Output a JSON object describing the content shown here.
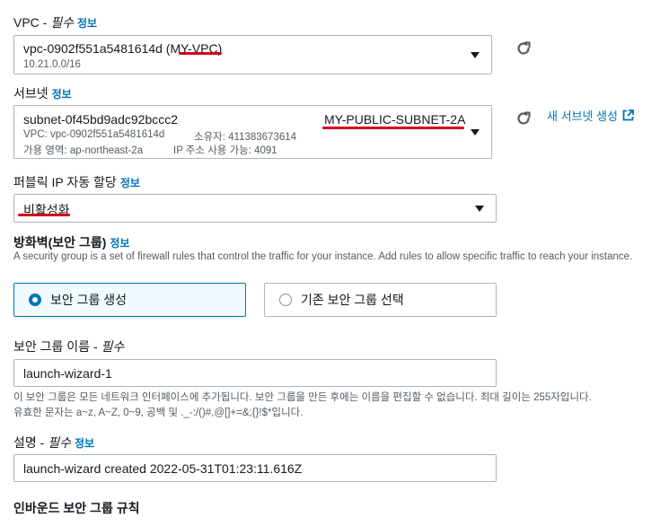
{
  "vpc": {
    "label": "VPC - ",
    "required": "필수",
    "info": "정보",
    "value_id": "vpc-0902f551a5481614d (",
    "value_name": "MY-VPC",
    "value_close": ")",
    "cidr": "10.21.0.0/16"
  },
  "subnet": {
    "label": "서브넷",
    "info": "정보",
    "value_id": "subnet-0f45bd9adc92bccc2",
    "value_name": "MY-PUBLIC-SUBNET-2A",
    "vpc_line": "VPC: vpc-0902f551a5481614d",
    "owner_line": "소유자: 411383673614",
    "az_line": "가용 영역: ap-northeast-2a",
    "ip_line": "IP 주소 사용 가능: 4091",
    "create_link": "새 서브넷 생성"
  },
  "public_ip": {
    "label": "퍼블릭 IP 자동 할당",
    "info": "정보",
    "value": "비활성화"
  },
  "firewall": {
    "heading": "방화벽(보안 그룹)",
    "info": "정보",
    "description": "A security group is a set of firewall rules that control the traffic for your instance. Add rules to allow specific traffic to reach your instance.",
    "option_create": "보안 그룹 생성",
    "option_existing": "기존 보안 그룹 선택",
    "selected": "보안 그룹 생성"
  },
  "sg_name": {
    "label": "보안 그룹 이름 - ",
    "required": "필수",
    "value": "launch-wizard-1",
    "help1": "이 보안 그룹은 모든 네트워크 인터페이스에 추가됩니다. 보안 그룹을 만든 후에는 이름을 편집할 수 없습니다. 최대 길이는 255자입니다.",
    "help2": "유효한 문자는 a~z, A~Z, 0~9, 공백 및 ._-:/()#,@[]+=&;{}!$*입니다."
  },
  "description": {
    "label": "설명 - ",
    "required": "필수",
    "info": "정보",
    "value": "launch-wizard created 2022-05-31T01:23:11.616Z"
  },
  "inbound": {
    "heading": "인바운드 보안 그룹 규칙"
  },
  "colors": {
    "accent": "#0073bb",
    "underline": "#d0021b",
    "border": "#aab7b8"
  }
}
